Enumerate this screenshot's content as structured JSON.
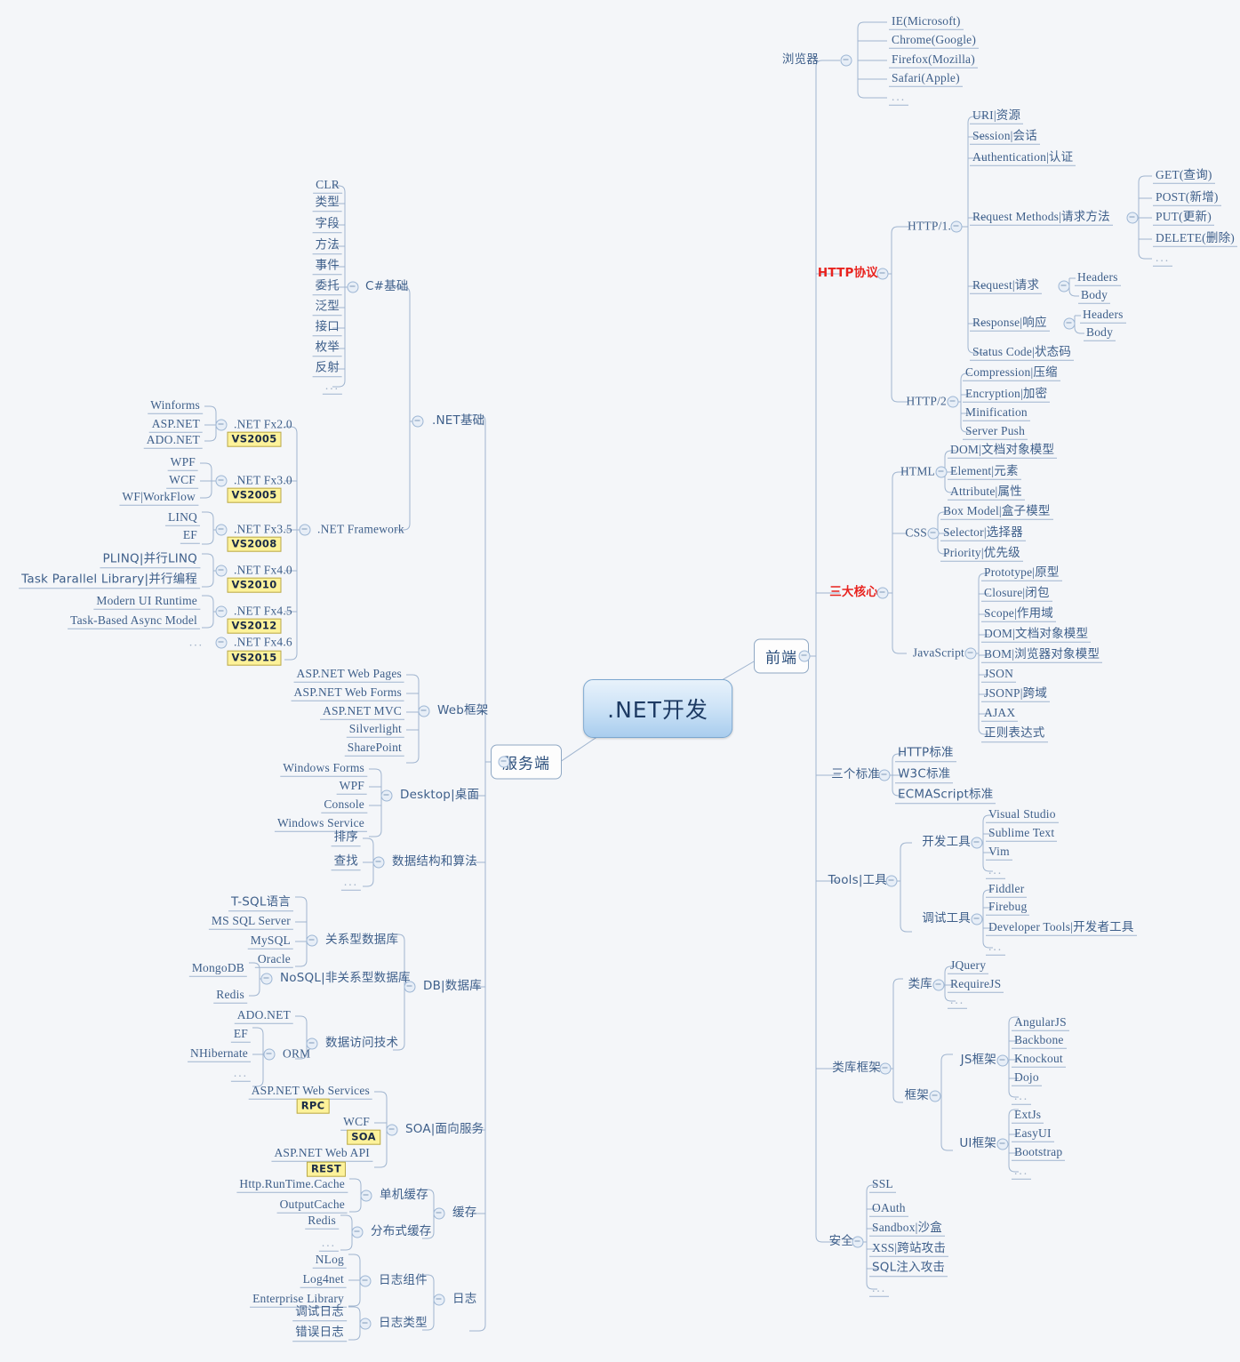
{
  "title": ".NET开发",
  "root": {
    "label": ".NET开发"
  },
  "branches": {
    "frontend": {
      "label": "前端"
    },
    "server": {
      "label": "服务端"
    }
  },
  "frontend": {
    "browser": {
      "label": "浏览器",
      "items": [
        "IE(Microsoft)",
        "Chrome(Google)",
        "Firefox(Mozilla)",
        "Safari(Apple)",
        "..."
      ]
    },
    "http": {
      "label": "HTTP协议",
      "http11": {
        "label": "HTTP/1.1",
        "items": [
          "URI|资源",
          "Session|会话",
          "Authentication|认证"
        ],
        "request_methods": {
          "label": "Request Methods|请求方法",
          "items": [
            "GET(查询)",
            "POST(新增)",
            "PUT(更新)",
            "DELETE(删除)",
            "..."
          ]
        },
        "request": {
          "label": "Request|请求",
          "items": [
            "Headers",
            "Body"
          ]
        },
        "response": {
          "label": "Response|响应",
          "items": [
            "Headers",
            "Body"
          ]
        },
        "status": "Status Code|状态码"
      },
      "http2": {
        "label": "HTTP/2",
        "items": [
          "Compression|压缩",
          "Encryption|加密",
          "Minification",
          "Server Push"
        ]
      }
    },
    "core": {
      "label": "三大核心",
      "html": {
        "label": "HTML",
        "items": [
          "DOM|文档对象模型",
          "Element|元素",
          "Attribute|属性"
        ]
      },
      "css": {
        "label": "CSS",
        "items": [
          "Box Model|盒子模型",
          "Selector|选择器",
          "Priority|优先级"
        ]
      },
      "javascript": {
        "label": "JavaScript",
        "items": [
          "Prototype|原型",
          "Closure|闭包",
          "Scope|作用域",
          "DOM|文档对象模型",
          "BOM|浏览器对象模型",
          "JSON",
          "JSONP|跨域",
          "AJAX",
          "正则表达式"
        ]
      }
    },
    "standards": {
      "label": "三个标准",
      "items": [
        "HTTP标准",
        "W3C标准",
        "ECMAScript标准"
      ]
    },
    "tools": {
      "label": "Tools|工具",
      "dev": {
        "label": "开发工具",
        "items": [
          "Visual Studio",
          "Sublime Text",
          "Vim",
          "..."
        ]
      },
      "debug": {
        "label": "调试工具",
        "items": [
          "Fiddler",
          "Firebug",
          "Developer Tools|开发者工具",
          "..."
        ]
      }
    },
    "libs": {
      "label": "类库框架",
      "library": {
        "label": "类库",
        "items": [
          "JQuery",
          "RequireJS",
          "..."
        ]
      },
      "framework": {
        "label": "框架",
        "js": {
          "label": "JS框架",
          "items": [
            "AngularJS",
            "Backbone",
            "Knockout",
            "Dojo",
            "..."
          ]
        },
        "ui": {
          "label": "UI框架",
          "items": [
            "ExtJs",
            "EasyUI",
            "Bootstrap",
            "..."
          ]
        }
      }
    },
    "security": {
      "label": "安全",
      "items": [
        "SSL",
        "OAuth",
        "Sandbox|沙盒",
        "XSS|跨站攻击",
        "SQL注入攻击",
        "..."
      ]
    }
  },
  "server": {
    "dotnet_basics": {
      "label": ".NET基础",
      "csharp": {
        "label": "C#基础",
        "items": [
          "CLR",
          "类型",
          "字段",
          "方法",
          "事件",
          "委托",
          "泛型",
          "接口",
          "枚举",
          "反射",
          "..."
        ]
      },
      "framework": {
        "label": ".NET Framework",
        "versions": [
          {
            "label": ".NET Fx2.0",
            "badge": "VS2005",
            "items": [
              "Winforms",
              "ASP.NET",
              "ADO.NET"
            ]
          },
          {
            "label": ".NET Fx3.0",
            "badge": "VS2005",
            "items": [
              "WPF",
              "WCF",
              "WF|WorkFlow"
            ]
          },
          {
            "label": ".NET Fx3.5",
            "badge": "VS2008",
            "items": [
              "LINQ",
              "EF"
            ]
          },
          {
            "label": ".NET Fx4.0",
            "badge": "VS2010",
            "items": [
              "PLINQ|并行LINQ",
              "Task Parallel Library|并行编程"
            ]
          },
          {
            "label": ".NET Fx4.5",
            "badge": "VS2012",
            "items": [
              "Modern UI Runtime",
              "Task-Based Async Model"
            ]
          },
          {
            "label": ".NET Fx4.6",
            "badge": "VS2015",
            "items": [
              "..."
            ]
          }
        ]
      }
    },
    "web": {
      "label": "Web框架",
      "items": [
        "ASP.NET Web Pages",
        "ASP.NET Web Forms",
        "ASP.NET MVC",
        "Silverlight",
        "SharePoint"
      ]
    },
    "desktop": {
      "label": "Desktop|桌面",
      "items": [
        "Windows Forms",
        "WPF",
        "Console",
        "Windows Service"
      ]
    },
    "algo": {
      "label": "数据结构和算法",
      "items": [
        "排序",
        "查找",
        "..."
      ]
    },
    "db": {
      "label": "DB|数据库",
      "relational": {
        "label": "关系型数据库",
        "items": [
          "T-SQL语言",
          "MS SQL Server",
          "MySQL",
          "Oracle"
        ]
      },
      "nosql": {
        "label": "NoSQL|非关系型数据库",
        "items": [
          "MongoDB",
          "Redis"
        ]
      },
      "access": {
        "label": "数据访问技术",
        "adonet": "ADO.NET",
        "orm": {
          "label": "ORM",
          "items": [
            "EF",
            "NHibernate",
            "..."
          ]
        }
      }
    },
    "soa": {
      "label": "SOA|面向服务",
      "items": [
        {
          "label": "ASP.NET Web Services",
          "badge": "RPC"
        },
        {
          "label": "WCF",
          "badge": "SOA"
        },
        {
          "label": "ASP.NET Web API",
          "badge": "REST"
        }
      ]
    },
    "cache": {
      "label": "缓存",
      "local": {
        "label": "单机缓存",
        "items": [
          "Http.RunTime.Cache",
          "OutputCache"
        ]
      },
      "distributed": {
        "label": "分布式缓存",
        "items": [
          "Redis",
          "..."
        ]
      }
    },
    "log": {
      "label": "日志",
      "components": {
        "label": "日志组件",
        "items": [
          "NLog",
          "Log4net",
          "Enterprise Library"
        ]
      },
      "types": {
        "label": "日志类型",
        "items": [
          "调试日志",
          "错误日志"
        ]
      }
    }
  },
  "colors": {
    "background": "#f4f6f9",
    "node_text": "#3e5f8a",
    "accent_red": "#e8231f",
    "line": "#9fb4cf",
    "badge_bg": "#fdf29a",
    "root_fill": "#a9cdee"
  }
}
